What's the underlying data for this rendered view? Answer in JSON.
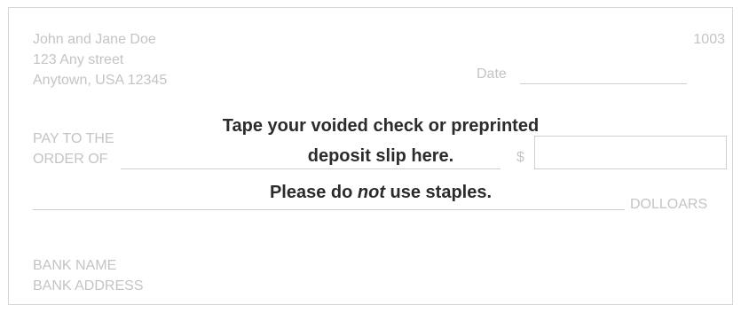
{
  "owner": {
    "name": "John and Jane Doe",
    "street": "123 Any street",
    "city": "Anytown, USA  12345"
  },
  "check_number": "1003",
  "date_label": "Date",
  "payee": {
    "label_line1": "PAY TO THE",
    "label_line2": "ORDER OF"
  },
  "dollar_sign": "$",
  "amount_words_label": "DOLLOARS",
  "bank": {
    "name": "BANK NAME",
    "address": "BANK ADDRESS"
  },
  "instructions": {
    "line1": "Tape your voided check or preprinted",
    "line2": "deposit slip here.",
    "line3_before": "Please do ",
    "line3_emphasis": "not",
    "line3_after": " use staples."
  },
  "colors": {
    "faint_text": "#c4c4c4",
    "instruction_text": "#2b2b2b",
    "border": "#d6d6d6"
  }
}
